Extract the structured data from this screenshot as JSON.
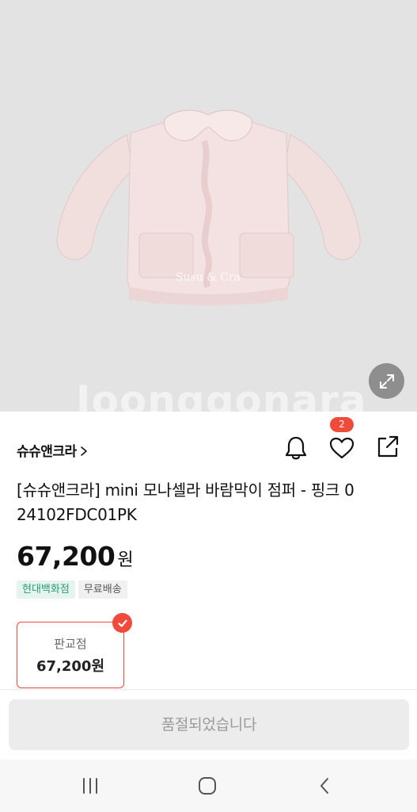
{
  "product_image": {
    "alt": "Susu & Cra",
    "watermark": "Joonggonara",
    "expand_icon": "expand-icon"
  },
  "brand": {
    "name": "슈슈앤크라",
    "chevron": ">"
  },
  "actions": {
    "bell_icon": "bell-icon",
    "heart_icon": "heart-icon",
    "share_icon": "share-icon",
    "like_count": "2"
  },
  "product": {
    "title": "[슈슈앤크라] mini 모나셀라 바람막이 점퍼 - 핑크 0 24102FDC01PK",
    "price": "67,200",
    "currency": "원",
    "tags": [
      "현대백화점",
      "무료배송"
    ]
  },
  "store_option": {
    "label": "판교점",
    "price": "67,200원",
    "selected": true
  },
  "purchase": {
    "button_label": "품절되었습니다"
  },
  "system_nav": {
    "recents_icon": "recents-icon",
    "home_icon": "home-icon",
    "back_icon": "back-icon"
  },
  "colors": {
    "accent": "#ef4a3c",
    "tag_green_text": "#2b9a77",
    "tag_green_bg": "#e5f4ef",
    "disabled_button_bg": "#ececec",
    "hero_bg": "#e3e3e3"
  }
}
